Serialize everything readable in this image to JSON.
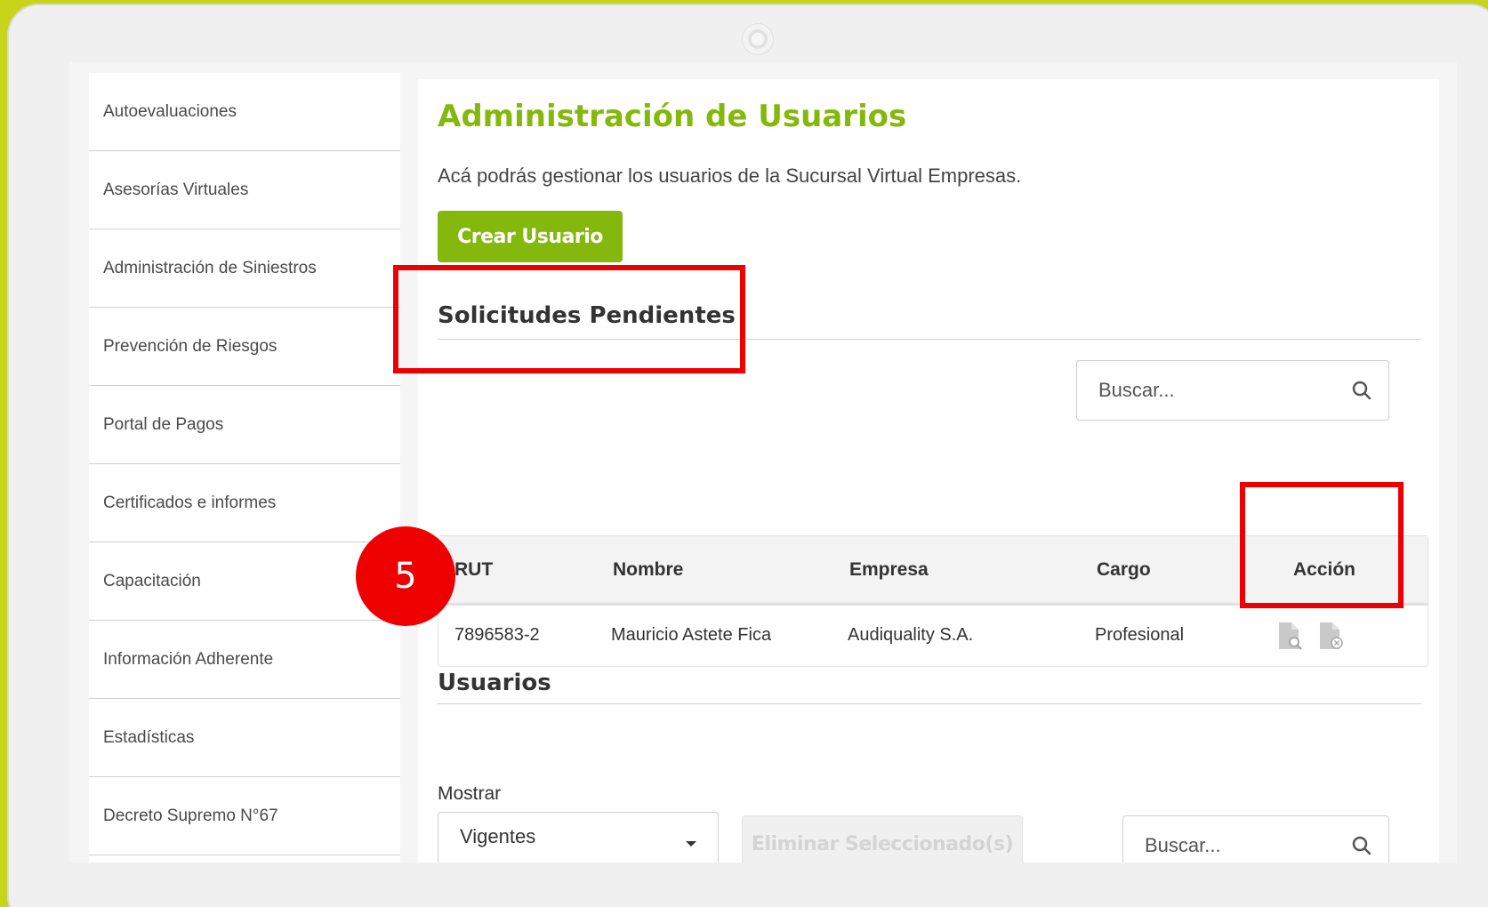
{
  "sidebar": {
    "items": [
      {
        "label": "Autoevaluaciones"
      },
      {
        "label": "Asesorías Virtuales"
      },
      {
        "label": "Administración de Siniestros"
      },
      {
        "label": "Prevención de Riesgos"
      },
      {
        "label": "Portal de Pagos"
      },
      {
        "label": "Certificados e informes"
      },
      {
        "label": "Capacitación"
      },
      {
        "label": "Información Adherente"
      },
      {
        "label": "Estadísticas"
      },
      {
        "label": "Decreto Supremo N°67"
      }
    ]
  },
  "main": {
    "title": "Administración de Usuarios",
    "intro": "Acá podrás gestionar los usuarios de la Sucursal Virtual Empresas.",
    "create_button": "Crear Usuario",
    "pending": {
      "title": "Solicitudes Pendientes",
      "search_placeholder": "Buscar...",
      "columns": [
        "RUT",
        "Nombre",
        "Empresa",
        "Cargo",
        "Acción"
      ],
      "rows": [
        {
          "rut": "7896583-2",
          "nombre": "Mauricio Astete Fica",
          "empresa": "Audiquality S.A.",
          "cargo": "Profesional"
        }
      ]
    },
    "users": {
      "title": "Usuarios",
      "show_label": "Mostrar",
      "show_value": "Vigentes",
      "delete_button": "Eliminar Seleccionado(s)",
      "search_placeholder": "Buscar..."
    }
  },
  "annotation": {
    "step_number": "5"
  },
  "colors": {
    "brand_green": "#84b80c",
    "annotation_red": "#ee0000",
    "background_lime": "#c8d41a"
  },
  "icons": [
    "search-icon",
    "view-document-icon",
    "reject-document-icon",
    "chevron-down-icon"
  ]
}
